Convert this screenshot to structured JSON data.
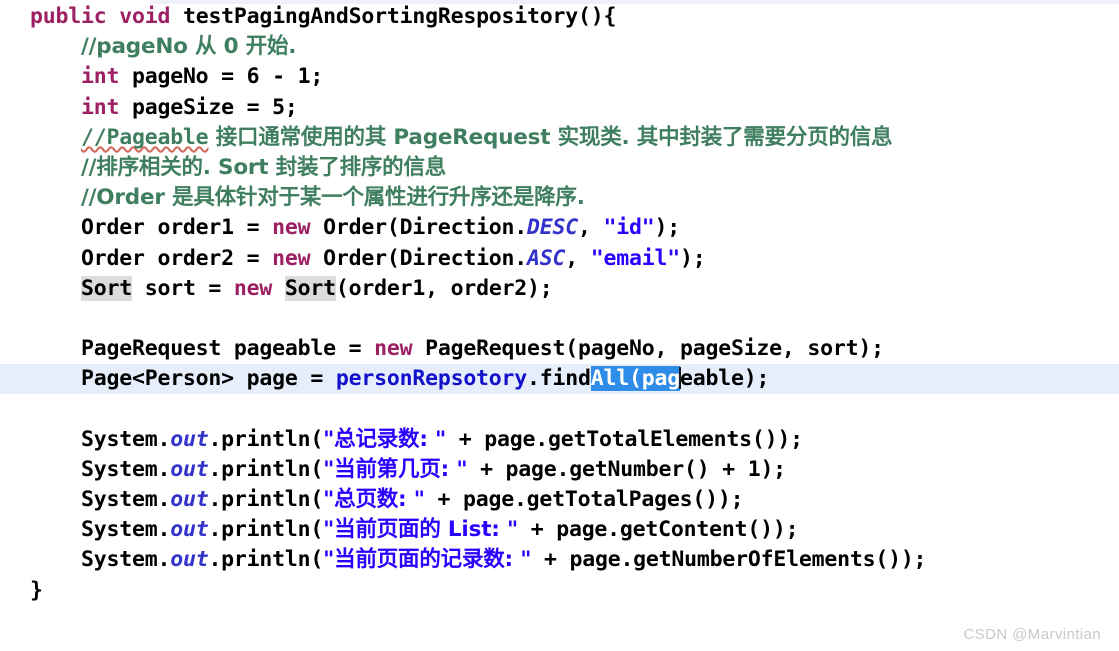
{
  "editor": {
    "language": "java",
    "background_color": "#ffffff",
    "current_line_highlight_color": "#e7eefb",
    "selection_color": "#2f8ce8",
    "occurrence_highlight_color": "#dcdcdc",
    "colors": {
      "keyword": "#9c2063",
      "comment": "#3f7f5f",
      "string": "#2a00ff",
      "field": "#1111cc",
      "static_field": "#3333cc",
      "plain": "#000000"
    }
  },
  "code": {
    "line1": {
      "kw_public": "public",
      "sp1": " ",
      "kw_void": "void",
      "sp2": " ",
      "method": "testPagingAndSortingRespository(){"
    },
    "line2": {
      "comment": "//pageNo 从 0 开始."
    },
    "line3": {
      "kw_int": "int",
      "rest": " pageNo = 6 - 1;"
    },
    "line4": {
      "kw_int": "int",
      "rest": " pageSize = 5;"
    },
    "line5": {
      "comment_a": "//Pageable",
      "comment_b": " 接口通常使用的其 PageRequest 实现类. 其中封装了需要分页的信息"
    },
    "line6": {
      "comment": "//排序相关的. Sort 封装了排序的信息"
    },
    "line7": {
      "comment": "//Order 是具体针对于某一个属性进行升序还是降序."
    },
    "line8": {
      "pre": "Order order1 = ",
      "kw_new": "new",
      "mid": " Order(Direction.",
      "statfld": "DESC",
      "comma": ", ",
      "str": "\"id\"",
      "post": ");"
    },
    "line9": {
      "pre": "Order order2 = ",
      "kw_new": "new",
      "mid": " Order(Direction.",
      "statfld": "ASC",
      "comma": ", ",
      "str": "\"email\"",
      "post": ");"
    },
    "line10": {
      "occ1": "Sort",
      "mid1": " sort = ",
      "kw_new": "new",
      "mid2": " ",
      "occ2": "Sort",
      "post": "(order1, order2);"
    },
    "line11": {
      "blank": " "
    },
    "line12": {
      "pre": "PageRequest pageable = ",
      "kw_new": "new",
      "post": " PageRequest(pageNo, pageSize, sort);"
    },
    "line13": {
      "pre": "Page<Person> page = ",
      "field": "personRepsotory",
      "dot": ".find",
      "selected": "All(pag",
      "post": "eable);"
    },
    "line14": {
      "blank": " "
    },
    "line15": {
      "sys": "System.",
      "out": "out",
      "print": ".println(",
      "str": "\"总记录数: \"",
      "post": " + page.getTotalElements());"
    },
    "line16": {
      "sys": "System.",
      "out": "out",
      "print": ".println(",
      "str": "\"当前第几页: \"",
      "post": " + page.getNumber() + 1);"
    },
    "line17": {
      "sys": "System.",
      "out": "out",
      "print": ".println(",
      "str": "\"总页数: \"",
      "post": " + page.getTotalPages());"
    },
    "line18": {
      "sys": "System.",
      "out": "out",
      "print": ".println(",
      "str": "\"当前页面的 List: \"",
      "post": " + page.getContent());"
    },
    "line19": {
      "sys": "System.",
      "out": "out",
      "print": ".println(",
      "str": "\"当前页面的记录数: \"",
      "post": " + page.getNumberOfElements());"
    },
    "line20": {
      "brace": "}"
    }
  },
  "watermark": {
    "text": "CSDN @Marvintian"
  }
}
